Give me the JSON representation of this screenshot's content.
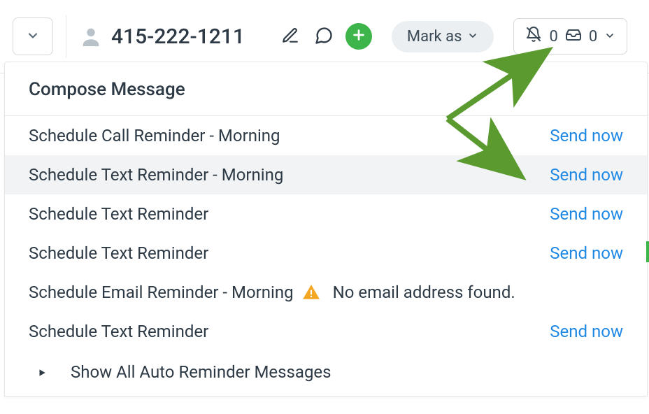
{
  "toolbar": {
    "phone": "415-222-1211",
    "markas_label": "Mark as",
    "bell_count": "0",
    "inbox_count": "0"
  },
  "panel": {
    "header": "Compose Message",
    "rows": [
      {
        "label": "Schedule Call Reminder - Morning",
        "action": "Send now",
        "highlight": false,
        "warning": null
      },
      {
        "label": "Schedule Text Reminder - Morning",
        "action": "Send now",
        "highlight": true,
        "warning": null
      },
      {
        "label": "Schedule Text Reminder",
        "action": "Send now",
        "highlight": false,
        "warning": null
      },
      {
        "label": "Schedule Text Reminder",
        "action": "Send now",
        "highlight": false,
        "warning": null
      },
      {
        "label": "Schedule Email Reminder - Morning",
        "action": null,
        "highlight": false,
        "warning": "No email address found."
      },
      {
        "label": "Schedule Text Reminder",
        "action": "Send now",
        "highlight": false,
        "warning": null
      }
    ],
    "show_all_label": "Show All Auto Reminder Messages"
  },
  "colors": {
    "green": "#3db54a",
    "link": "#1e88e5",
    "warn": "#f5a623"
  }
}
